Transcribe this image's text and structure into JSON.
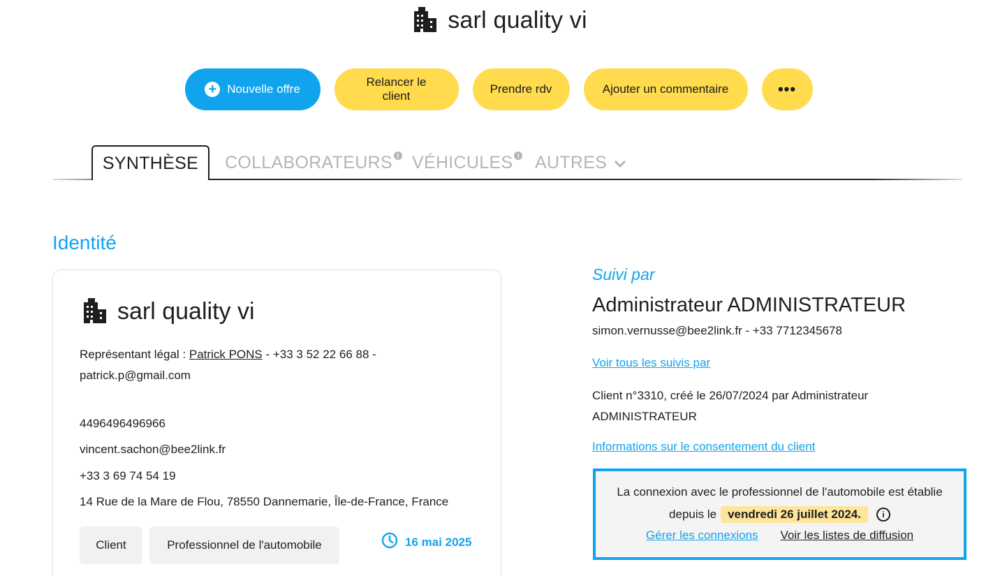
{
  "header": {
    "title": "sarl quality vi",
    "icon": "building-icon"
  },
  "actions": {
    "new_offer": "Nouvelle offre",
    "relaunch": "Relancer le client",
    "appointment": "Prendre rdv",
    "comment": "Ajouter un commentaire",
    "more": "•••"
  },
  "tabs": {
    "synthese": "SYNTHÈSE",
    "collaborateurs": "COLLABORATEURS",
    "vehicules": "VÉHICULES",
    "autres": "AUTRES",
    "info_mark": "i"
  },
  "identity": {
    "section_title": "Identité",
    "name": "sarl quality vi",
    "rep_label": "Représentant légal : ",
    "rep_name": "Patrick PONS",
    "rep_details": " - +33 3 52 22 66 88 - patrick.p@gmail.com",
    "siret": "4496496496966",
    "email": "vincent.sachon@bee2link.fr",
    "phone": "+33 3 69 74 54 19",
    "address": "14 Rue de la Mare de Flou, 78550 Dannemarie, Île-de-France, France",
    "tags": [
      "Client",
      "Professionnel de l'automobile"
    ],
    "date": "16 mai 2025"
  },
  "followup": {
    "label": "Suivi par",
    "name": "Administrateur ADMINISTRATEUR",
    "contact": "simon.vernusse@bee2link.fr - +33 7712345678",
    "see_all_link": "Voir tous les suivis par",
    "client_info": "Client n°3310, créé le 26/07/2024 par Administrateur ADMINISTRATEUR",
    "consent_link": "Informations sur le consentement du client"
  },
  "connection": {
    "line1": "La connexion avec le professionnel de l'automobile est établie",
    "since": "depuis le",
    "date": "vendredi 26 juillet 2024.",
    "info_mark": "i",
    "manage_link": "Gérer les connexions",
    "lists_link": "Voir les listes de diffusion"
  },
  "colors": {
    "accent": "#10a3ee",
    "yellow": "#ffdb4d",
    "highlight": "#fde59a"
  }
}
